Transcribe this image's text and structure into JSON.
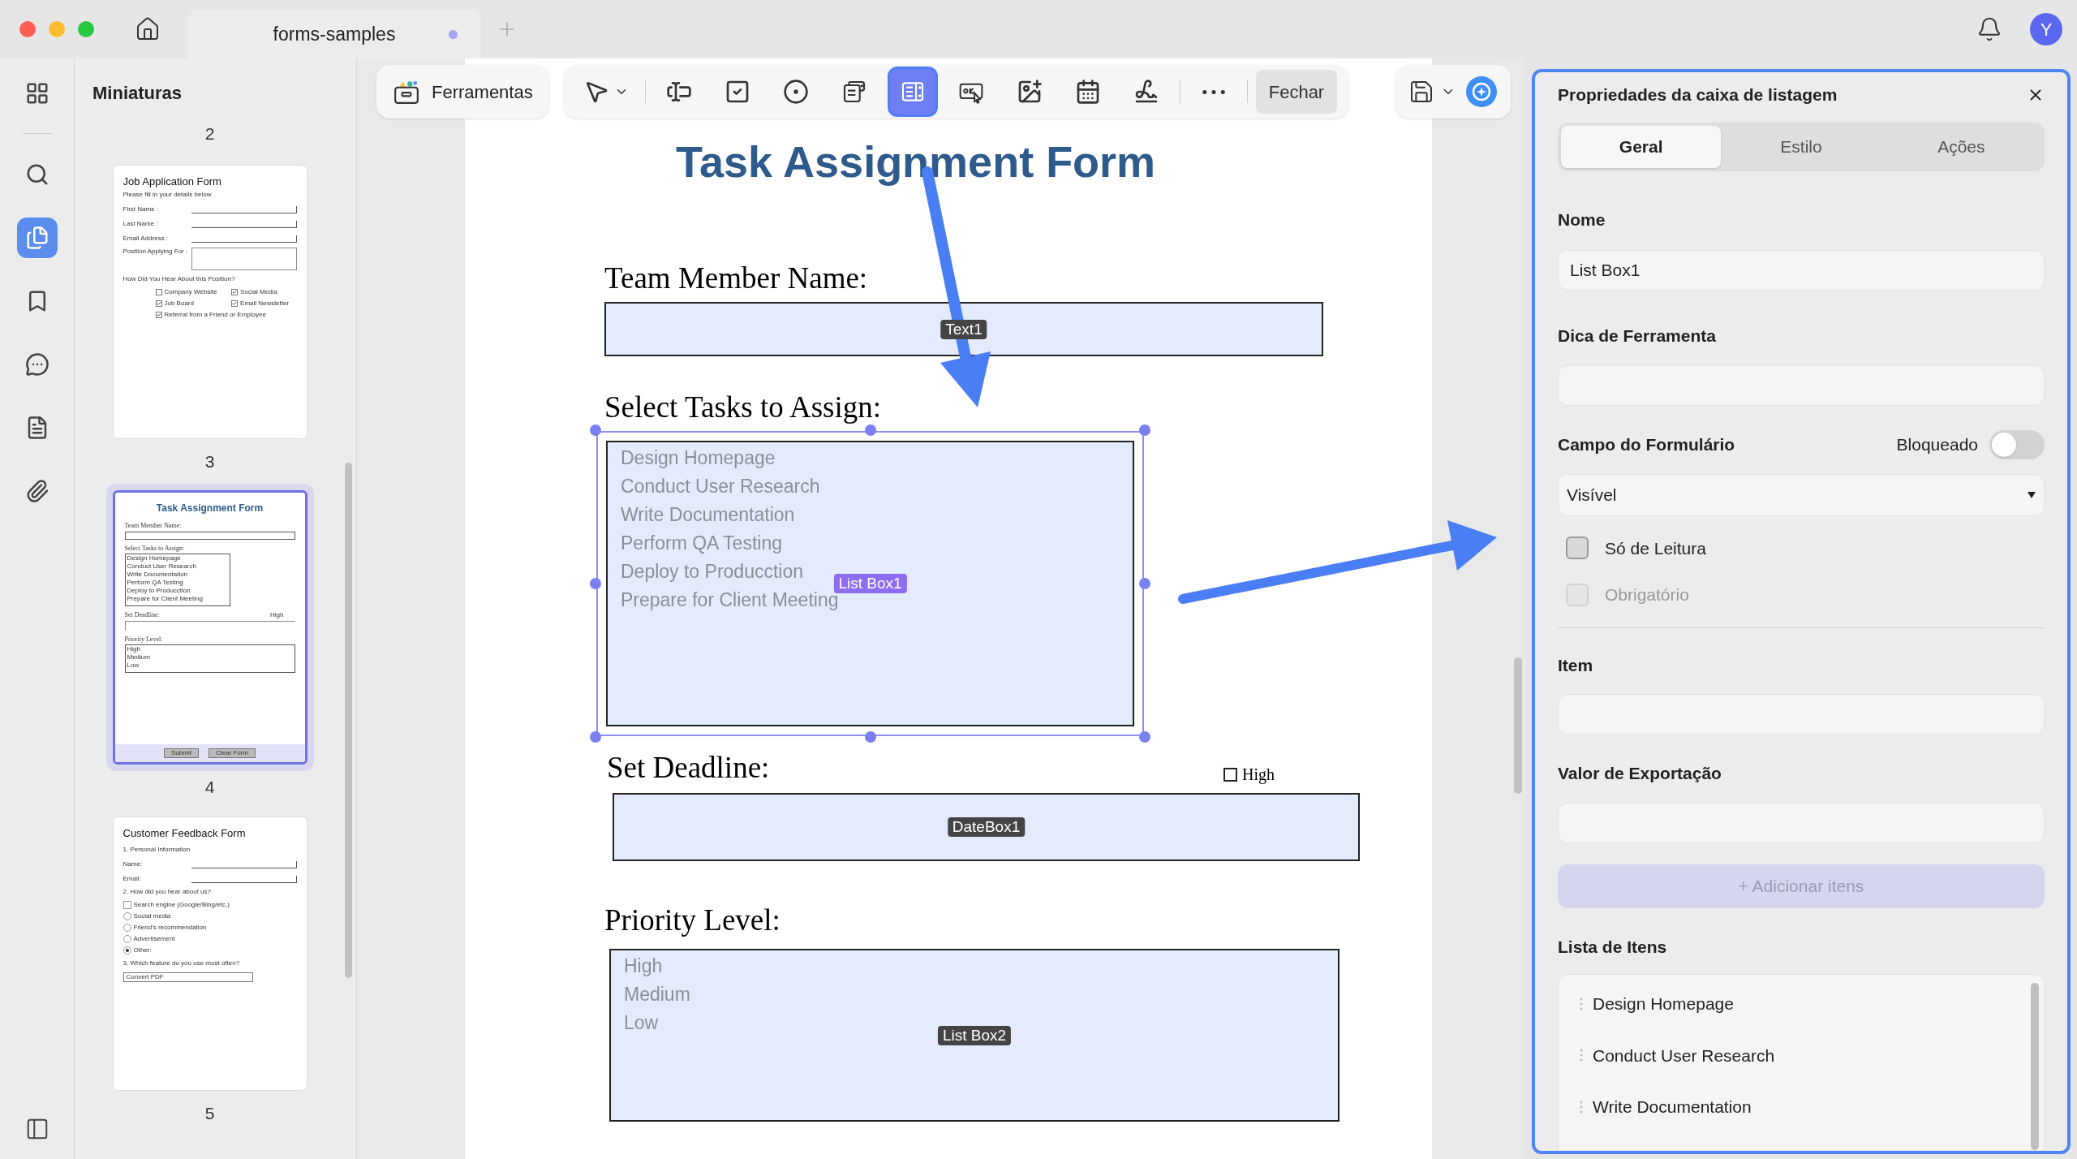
{
  "window": {
    "tab_title": "forms-samples",
    "unsaved": true,
    "avatar": "Y"
  },
  "rail": [
    {
      "kind": "apps",
      "selected": false
    },
    {
      "kind": "search",
      "selected": false
    },
    {
      "kind": "pages",
      "selected": true
    },
    {
      "kind": "bookmarks",
      "selected": false
    },
    {
      "kind": "comments",
      "selected": false
    },
    {
      "kind": "forms",
      "selected": false
    },
    {
      "kind": "attachments",
      "selected": false
    }
  ],
  "thumbnails": {
    "title": "Miniaturas",
    "lead_number": "2",
    "pages": [
      {
        "number": "3",
        "selected": false,
        "blocks": [
          {
            "kind": "heading",
            "text": "Job Application Form"
          },
          {
            "kind": "subtitle",
            "text": "Please fill in your details below"
          },
          {
            "kind": "label_field",
            "text": "First Name :"
          },
          {
            "kind": "label_field",
            "text": "Last Name :"
          },
          {
            "kind": "label_field",
            "text": "Email Address :"
          },
          {
            "kind": "label_box",
            "text": "Position Applying For :"
          },
          {
            "kind": "label",
            "text": "How Did You Hear About this Position?"
          },
          {
            "kind": "check_grid",
            "items": [
              {
                "label": "Company Website",
                "checked": false
              },
              {
                "label": "Social Media",
                "checked": true
              },
              {
                "label": "Job Board",
                "checked": true
              },
              {
                "label": "Email Newsletter",
                "checked": true
              },
              {
                "label": "Referral from a Friend or Employee",
                "checked": true
              }
            ]
          }
        ]
      },
      {
        "number": "4",
        "selected": true,
        "blocks": [
          {
            "kind": "heading",
            "text": "Task Assignment Form"
          },
          {
            "kind": "label_line",
            "text": "Team Member Name:"
          },
          {
            "kind": "listbox",
            "text": "Select Tasks to Assign:",
            "items": [
              "Design Homepage",
              "Conduct User Research",
              "Write Documentation",
              "Perform QA Testing",
              "Deploy to Producction",
              "Prepare for Client Meeting"
            ]
          },
          {
            "kind": "label_aside",
            "text": "Set Deadline:",
            "aside": "High"
          },
          {
            "kind": "listbox",
            "text": "Priority Level:",
            "items": [
              "High",
              "Medium",
              "Low"
            ]
          },
          {
            "kind": "buttons",
            "items": [
              "Submit",
              "Clear Form"
            ]
          }
        ]
      },
      {
        "number": "5",
        "selected": false,
        "blocks": [
          {
            "kind": "heading",
            "text": "Customer Feedback Form"
          },
          {
            "kind": "label",
            "text": "1. Personal Information"
          },
          {
            "kind": "label_field",
            "text": "Name:"
          },
          {
            "kind": "label_field",
            "text": "Email:"
          },
          {
            "kind": "label",
            "text": "2. How did you hear about us?"
          },
          {
            "kind": "choices",
            "items": [
              {
                "label": "Search engine (Google/Bing/etc.)",
                "kind": "checkbox",
                "checked": false
              },
              {
                "label": "Social media",
                "kind": "radio",
                "checked": false
              },
              {
                "label": "Friend's recommendation",
                "kind": "radio",
                "checked": false
              },
              {
                "label": "Advertisement",
                "kind": "radio",
                "checked": false
              },
              {
                "label": "Other:",
                "kind": "radio",
                "checked": true
              }
            ]
          },
          {
            "kind": "label",
            "text": "3. Which feature do you use most often?"
          },
          {
            "kind": "select",
            "text": "Convert PDF"
          }
        ]
      }
    ]
  },
  "toolbar": {
    "tools_button": "Ferramentas",
    "tools": [
      {
        "kind": "select",
        "selected": false
      },
      {
        "kind": "text_field",
        "selected": false
      },
      {
        "kind": "checkbox",
        "selected": false
      },
      {
        "kind": "radio",
        "selected": false
      },
      {
        "kind": "combo_box",
        "selected": false
      },
      {
        "kind": "list_box",
        "selected": true
      },
      {
        "kind": "button",
        "selected": false
      },
      {
        "kind": "image",
        "selected": false
      },
      {
        "kind": "date",
        "selected": false
      },
      {
        "kind": "signature",
        "selected": false
      }
    ],
    "close_button": "Fechar"
  },
  "document": {
    "title": "Task Assignment Form",
    "sections": [
      {
        "kind": "text",
        "label": "Team Member Name:",
        "tag": "Text1",
        "selected": false
      },
      {
        "kind": "list",
        "label": "Select Tasks to Assign:",
        "tag": "List Box1",
        "selected": true,
        "items": [
          "Design Homepage",
          "Conduct User Research",
          "Write Documentation",
          "Perform QA Testing",
          "Deploy to Producction",
          "Prepare for Client Meeting"
        ]
      },
      {
        "kind": "date",
        "label": "Set Deadline:",
        "tag": "DateBox1",
        "selected": false,
        "aside": {
          "label": "High",
          "checked": false
        }
      },
      {
        "kind": "list",
        "label": "Priority Level:",
        "tag": "List Box2",
        "selected": false,
        "items": [
          "High",
          "Medium",
          "Low"
        ]
      }
    ]
  },
  "panel": {
    "title": "Propriedades da caixa de listagem",
    "tabs": [
      {
        "label": "Geral",
        "selected": true
      },
      {
        "label": "Estilo",
        "selected": false
      },
      {
        "label": "Ações",
        "selected": false
      }
    ],
    "name": {
      "label": "Nome",
      "value": "List Box1"
    },
    "tooltip": {
      "label": "Dica de Ferramenta"
    },
    "form_field": {
      "label": "Campo do Formulário",
      "lock_label": "Bloqueado",
      "locked": false,
      "visibility": "Visível"
    },
    "options": [
      {
        "label": "Só de Leitura",
        "checked": false,
        "disabled": false
      },
      {
        "label": "Obrigatório",
        "checked": false,
        "disabled": true
      }
    ],
    "item": {
      "label": "Item"
    },
    "export_value": {
      "label": "Valor de Exportação"
    },
    "add_button": {
      "label": "+ Adicionar itens",
      "disabled": true
    },
    "item_list": {
      "label": "Lista de Itens",
      "items": [
        "Design Homepage",
        "Conduct User Research",
        "Write Documentation"
      ]
    }
  }
}
